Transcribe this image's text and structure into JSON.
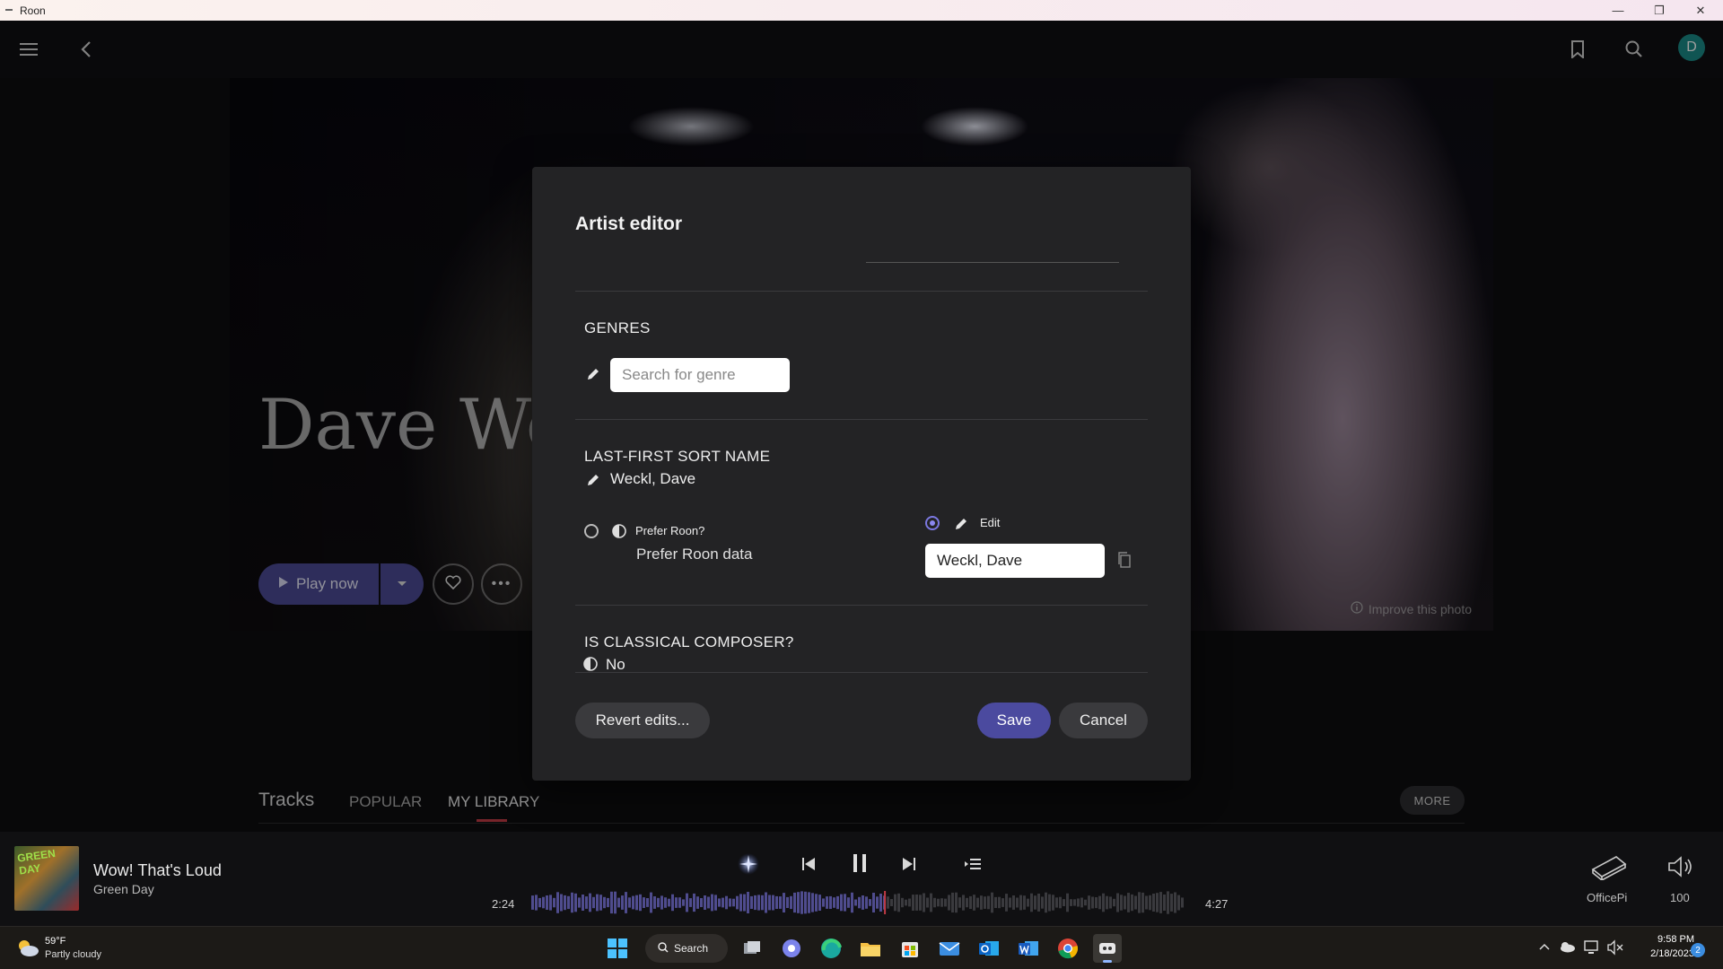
{
  "window": {
    "title": "Roon"
  },
  "hero": {
    "artist_name": "Dave Weckl Ba",
    "play_now_label": "Play now",
    "improve_photo_label": "Improve this photo"
  },
  "tracks": {
    "title": "Tracks",
    "tabs": [
      {
        "label": "POPULAR",
        "active": false
      },
      {
        "label": "MY LIBRARY",
        "active": true
      }
    ],
    "more_label": "MORE"
  },
  "modal": {
    "title": "Artist editor",
    "genres": {
      "label": "GENRES",
      "search_placeholder": "Search for genre"
    },
    "sort_name": {
      "label": "LAST-FIRST SORT NAME",
      "current_value": "Weckl, Dave",
      "prefer_roon_label": "Prefer Roon?",
      "prefer_roon_desc": "Prefer Roon data",
      "edit_label": "Edit",
      "edit_value": "Weckl, Dave",
      "selected": "edit"
    },
    "classical": {
      "label": "IS CLASSICAL COMPOSER?",
      "value": "No"
    },
    "buttons": {
      "revert": "Revert edits...",
      "save": "Save",
      "cancel": "Cancel"
    }
  },
  "player": {
    "track_title": "Wow! That's Loud",
    "track_artist": "Green Day",
    "album_art_text": "GREEN DAY",
    "time_elapsed": "2:24",
    "time_total": "4:27",
    "progress_fraction": 0.54,
    "zone_name": "OfficePi",
    "volume": "100"
  },
  "taskbar": {
    "weather_temp": "59°F",
    "weather_desc": "Partly cloudy",
    "search_label": "Search",
    "time": "9:58 PM",
    "date": "2/18/2023",
    "notification_count": "2"
  },
  "colors": {
    "accent": "#4b4a9f",
    "active_tab_underline": "#c03a45",
    "radio_selected": "#8b88f0",
    "avatar": "#1a8a86"
  },
  "icons": {
    "menu": "menu-icon",
    "back": "back-icon",
    "bookmark": "bookmark-icon",
    "search": "search-icon",
    "pencil": "pencil-icon",
    "copy": "copy-icon",
    "heart": "heart-icon",
    "more": "more-icon",
    "radiance": "radiance-icon",
    "prev": "previous-icon",
    "pause": "pause-icon",
    "next": "next-icon",
    "queue": "queue-icon",
    "volume": "volume-icon",
    "zone": "zone-device-icon"
  },
  "user": {
    "avatar_letter": "D"
  }
}
